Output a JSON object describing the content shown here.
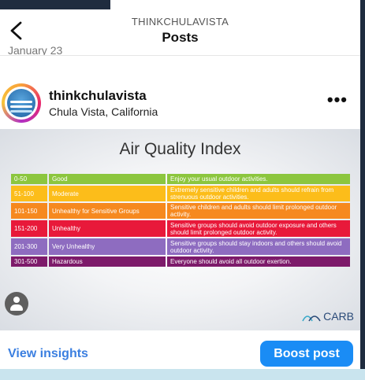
{
  "nav": {
    "account": "THINKCHULAVISTA",
    "title": "Posts"
  },
  "date_peek": "January 23",
  "post": {
    "username": "thinkchulavista",
    "location": "Chula Vista, California",
    "more_icon": "•••"
  },
  "aqi": {
    "title": "Air Quality Index",
    "rows": [
      {
        "range": "0-50",
        "category": "Good",
        "message": "Enjoy your usual outdoor activities.",
        "color": "#8cc63e"
      },
      {
        "range": "51-100",
        "category": "Moderate",
        "message": "Extremely sensitive children and adults should refrain from strenuous outdoor activities.",
        "color": "#fcbd1a"
      },
      {
        "range": "101-150",
        "category": "Unhealthy for Sensitive Groups",
        "message": "Sensitive children and adults should limit prolonged outdoor activity.",
        "color": "#f6891f"
      },
      {
        "range": "151-200",
        "category": "Unhealthy",
        "message": "Sensitive groups should avoid outdoor exposure and others should limit prolonged outdoor activity.",
        "color": "#e8193a"
      },
      {
        "range": "201-300",
        "category": "Very Unhealthy",
        "message": "Sensitive groups should stay indoors and others should avoid outdoor activity.",
        "color": "#8e6cc0"
      },
      {
        "range": "301-500",
        "category": "Hazardous",
        "message": "Everyone should avoid all outdoor exertion.",
        "color": "#7d1a6a"
      }
    ],
    "logo_text": "CARB"
  },
  "footer": {
    "insights": "View insights",
    "boost": "Boost post"
  },
  "colors": {
    "link_blue": "#3b7fe0",
    "button_blue": "#1a8cf5"
  }
}
